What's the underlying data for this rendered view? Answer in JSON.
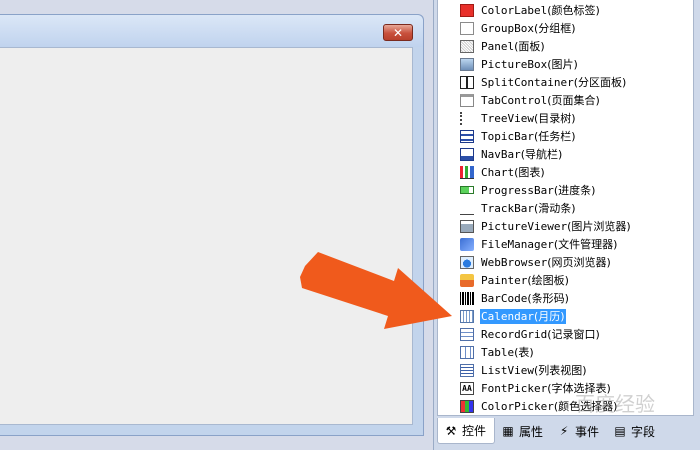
{
  "form": {
    "close_glyph": "✕"
  },
  "toolbox": {
    "items": [
      {
        "name": "ColorLabel",
        "zh": "(颜色标签)",
        "icon": "color-label-icon"
      },
      {
        "name": "GroupBox",
        "zh": "(分组框)",
        "icon": "group-box-icon"
      },
      {
        "name": "Panel",
        "zh": "(面板)",
        "icon": "panel-icon"
      },
      {
        "name": "PictureBox",
        "zh": "(图片)",
        "icon": "picture-box-icon"
      },
      {
        "name": "SplitContainer",
        "zh": "(分区面板)",
        "icon": "split-container-icon"
      },
      {
        "name": "TabControl",
        "zh": "(页面集合)",
        "icon": "tab-control-icon"
      },
      {
        "name": "TreeView",
        "zh": "(目录树)",
        "icon": "tree-view-icon"
      },
      {
        "name": "TopicBar",
        "zh": "(任务栏)",
        "icon": "topic-bar-icon"
      },
      {
        "name": "NavBar",
        "zh": "(导航栏)",
        "icon": "nav-bar-icon"
      },
      {
        "name": "Chart",
        "zh": "(图表)",
        "icon": "chart-icon"
      },
      {
        "name": "ProgressBar",
        "zh": "(进度条)",
        "icon": "progress-bar-icon"
      },
      {
        "name": "TrackBar",
        "zh": "(滑动条)",
        "icon": "track-bar-icon"
      },
      {
        "name": "PictureViewer",
        "zh": "(图片浏览器)",
        "icon": "picture-viewer-icon"
      },
      {
        "name": "FileManager",
        "zh": "(文件管理器)",
        "icon": "file-manager-icon"
      },
      {
        "name": "WebBrowser",
        "zh": "(网页浏览器)",
        "icon": "web-browser-icon"
      },
      {
        "name": "Painter",
        "zh": "(绘图板)",
        "icon": "painter-icon"
      },
      {
        "name": "BarCode",
        "zh": "(条形码)",
        "icon": "barcode-icon"
      },
      {
        "name": "Calendar",
        "zh": "(月历)",
        "icon": "calendar-icon",
        "selected": true
      },
      {
        "name": "RecordGrid",
        "zh": "(记录窗口)",
        "icon": "record-grid-icon"
      },
      {
        "name": "Table",
        "zh": "(表)",
        "icon": "table-icon"
      },
      {
        "name": "ListView",
        "zh": "(列表视图)",
        "icon": "list-view-icon"
      },
      {
        "name": "FontPicker",
        "zh": "(字体选择表)",
        "icon": "font-picker-icon",
        "glyph": "AA"
      },
      {
        "name": "ColorPicker",
        "zh": "(颜色选择器)",
        "icon": "color-picker-icon"
      }
    ],
    "tabs": [
      {
        "label": "控件",
        "icon": "tools-icon",
        "glyph": "⚒",
        "active": true
      },
      {
        "label": "属性",
        "icon": "properties-icon",
        "glyph": "▦"
      },
      {
        "label": "事件",
        "icon": "lightning-icon",
        "glyph": "⚡"
      },
      {
        "label": "字段",
        "icon": "field-icon",
        "glyph": "▤"
      }
    ]
  },
  "watermark": "百度经验",
  "colors": {
    "arrow": "#f05a1c",
    "selection": "#3399ff",
    "form_bg": "#c2d4ec"
  }
}
